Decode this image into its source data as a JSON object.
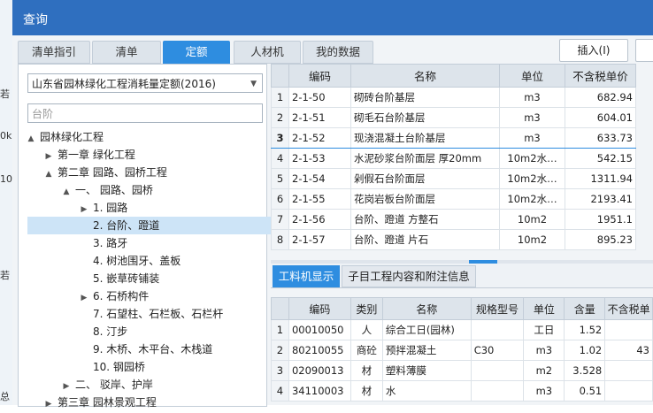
{
  "background_window": {
    "snippets": [
      "若",
      "0k",
      "10",
      "若",
      "总"
    ]
  },
  "dialog": {
    "title": "查询"
  },
  "tabs": [
    "清单指引",
    "清单",
    "定额",
    "人材机",
    "我的数据"
  ],
  "active_tab": "定额",
  "insert_button": "插入(I)",
  "quota_library": "山东省园林绿化工程消耗量定额(2016)",
  "search_value": "台阶",
  "tree": [
    {
      "label": "园林绿化工程",
      "level": 0,
      "arrow": "▲"
    },
    {
      "label": "第一章 绿化工程",
      "level": 1,
      "arrow": "▶"
    },
    {
      "label": "第二章 园路、园桥工程",
      "level": 1,
      "arrow": "▲"
    },
    {
      "label": "一、 园路、园桥",
      "level": 2,
      "arrow": "▲"
    },
    {
      "label": "1. 园路",
      "level": 3,
      "arrow": "▶"
    },
    {
      "label": "2. 台阶、蹬道",
      "level": 3,
      "arrow": "",
      "selected": true
    },
    {
      "label": "3. 路牙",
      "level": 3,
      "arrow": ""
    },
    {
      "label": "4. 树池围牙、盖板",
      "level": 3,
      "arrow": ""
    },
    {
      "label": "5. 嵌草砖铺装",
      "level": 3,
      "arrow": ""
    },
    {
      "label": "6. 石桥构件",
      "level": 3,
      "arrow": "▶"
    },
    {
      "label": "7. 石望柱、石栏板、石栏杆",
      "level": 3,
      "arrow": ""
    },
    {
      "label": "8. 汀步",
      "level": 3,
      "arrow": ""
    },
    {
      "label": "9. 木桥、木平台、木栈道",
      "level": 3,
      "arrow": ""
    },
    {
      "label": "10. 钢园桥",
      "level": 3,
      "arrow": ""
    },
    {
      "label": "二、 驳岸、护岸",
      "level": 2,
      "arrow": "▶"
    },
    {
      "label": "第三章 园林景观工程",
      "level": 1,
      "arrow": "▶"
    }
  ],
  "quota_table": {
    "headers": [
      "",
      "编码",
      "名称",
      "单位",
      "不含税单价"
    ],
    "rows": [
      {
        "n": "1",
        "code": "2-1-50",
        "name": "砌砖台阶基层",
        "unit": "m3",
        "price": "682.94"
      },
      {
        "n": "2",
        "code": "2-1-51",
        "name": "砌毛石台阶基层",
        "unit": "m3",
        "price": "604.01"
      },
      {
        "n": "3",
        "code": "2-1-52",
        "name": "现浇混凝土台阶基层",
        "unit": "m3",
        "price": "633.73",
        "selected": true
      },
      {
        "n": "4",
        "code": "2-1-53",
        "name": "水泥砂浆台阶面层 厚20mm",
        "unit": "10m2水…",
        "price": "542.15"
      },
      {
        "n": "5",
        "code": "2-1-54",
        "name": "剁假石台阶面层",
        "unit": "10m2水…",
        "price": "1311.94"
      },
      {
        "n": "6",
        "code": "2-1-55",
        "name": "花岗岩板台阶面层",
        "unit": "10m2水…",
        "price": "2193.41"
      },
      {
        "n": "7",
        "code": "2-1-56",
        "name": "台阶、蹬道 方整石",
        "unit": "10m2",
        "price": "1951.1"
      },
      {
        "n": "8",
        "code": "2-1-57",
        "name": "台阶、蹬道 片石",
        "unit": "10m2",
        "price": "895.23"
      }
    ]
  },
  "bottom_tabs": [
    "工料机显示",
    "子目工程内容和附注信息"
  ],
  "active_bottom_tab": "工料机显示",
  "resource_table": {
    "headers": [
      "",
      "编码",
      "类别",
      "名称",
      "规格型号",
      "单位",
      "含量",
      "不含税单"
    ],
    "rows": [
      {
        "n": "1",
        "code": "00010050",
        "cat": "人",
        "name": "综合工日(园林)",
        "spec": "",
        "unit": "工日",
        "qty": "1.52",
        "price": ""
      },
      {
        "n": "2",
        "code": "80210055",
        "cat": "商砼",
        "name": "预拌混凝土",
        "spec": "C30",
        "unit": "m3",
        "qty": "1.02",
        "price": "43"
      },
      {
        "n": "3",
        "code": "02090013",
        "cat": "材",
        "name": "塑料薄膜",
        "spec": "",
        "unit": "m2",
        "qty": "3.528",
        "price": ""
      },
      {
        "n": "4",
        "code": "34110003",
        "cat": "材",
        "name": "水",
        "spec": "",
        "unit": "m3",
        "qty": "0.51",
        "price": ""
      }
    ]
  }
}
